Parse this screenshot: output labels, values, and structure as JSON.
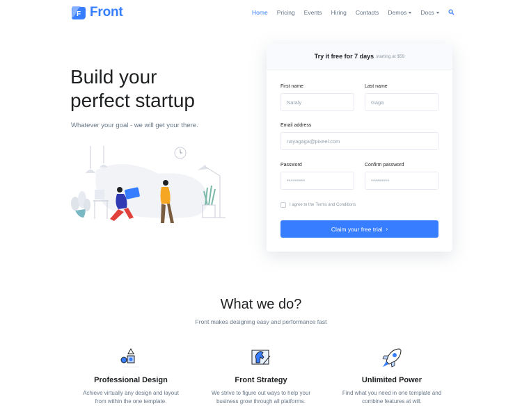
{
  "brand": {
    "name": "Front",
    "accent": "#377dff"
  },
  "nav": {
    "items": [
      {
        "label": "Home",
        "active": true
      },
      {
        "label": "Pricing"
      },
      {
        "label": "Events"
      },
      {
        "label": "Hiring"
      },
      {
        "label": "Contacts"
      },
      {
        "label": "Demos",
        "dropdown": true
      },
      {
        "label": "Docs",
        "dropdown": true
      }
    ],
    "search_icon": "search-icon"
  },
  "hero": {
    "title_line1": "Build your",
    "title_line2": "perfect startup",
    "subtitle": "Whatever your goal - we will get your there."
  },
  "form": {
    "header_main": "Try it free for 7 days",
    "header_small": "starting at $59",
    "first_name_label": "First name",
    "first_name_placeholder": "Nataly",
    "last_name_label": "Last name",
    "last_name_placeholder": "Gaga",
    "email_label": "Email address",
    "email_placeholder": "nayagaga@pixeel.com",
    "password_label": "Password",
    "password_placeholder": "*********",
    "confirm_label": "Confirm password",
    "confirm_placeholder": "*********",
    "terms_text": "I agree to the",
    "terms_link": "Terms and Conditions",
    "cta_label": "Claim your free trial",
    "cta_icon": "chevron-right-icon"
  },
  "section": {
    "title": "What we do?",
    "subtitle": "Front makes designing easy and performance fast"
  },
  "features": [
    {
      "icon": "shapes-icon",
      "title": "Professional Design",
      "desc_line1": "Achieve virtually any design and layout",
      "desc_line2": "from within the one template."
    },
    {
      "icon": "chess-knight-icon",
      "title": "Front Strategy",
      "desc_line1": "We strive to figure out ways to help your",
      "desc_line2": "business grow through all platforms."
    },
    {
      "icon": "rocket-icon",
      "title": "Unlimited Power",
      "desc_line1": "Find what you need in one template and",
      "desc_line2": "combine features at will."
    }
  ]
}
